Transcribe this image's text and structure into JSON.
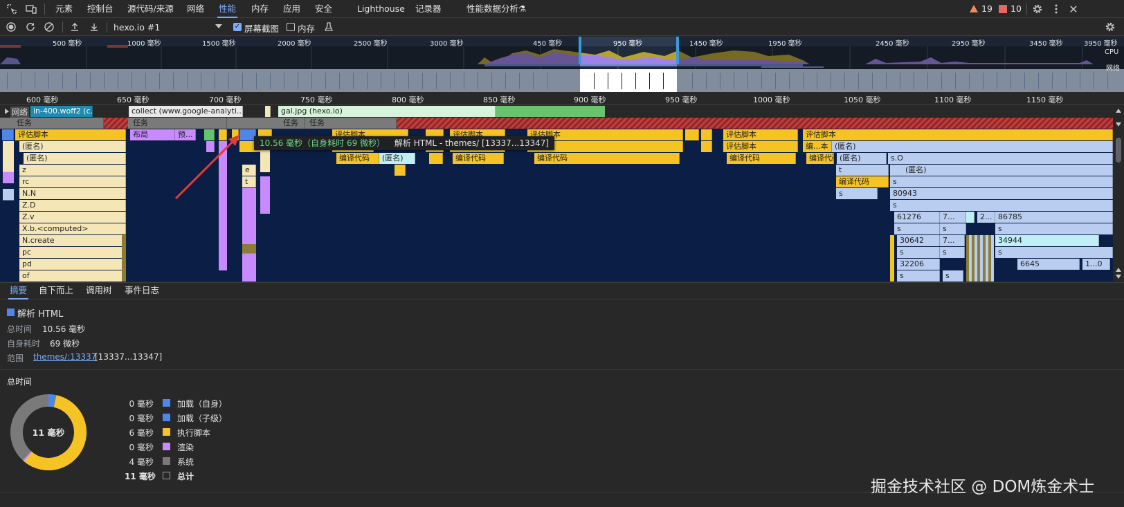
{
  "tabs": [
    "元素",
    "控制台",
    "源代码/来源",
    "网络",
    "性能",
    "内存",
    "应用",
    "安全",
    "Lighthouse",
    "记录器",
    "性能数据分析"
  ],
  "tab_beaker": "⚗",
  "warn_count": "19",
  "error_count": "10",
  "toolbar": {
    "profile": "hexo.io #1",
    "screenshot_label": "屏幕截图",
    "memory_label": "内存"
  },
  "overview_ticks": [
    "500 毫秒",
    "1000 毫秒",
    "1500 毫秒",
    "2000 毫秒",
    "2500 毫秒",
    "3000 毫秒",
    "450 毫秒",
    "950 毫秒",
    "1450 毫秒",
    "1950 毫秒",
    "2450 毫秒",
    "2950 毫秒",
    "3450 毫秒",
    "3950 毫秒"
  ],
  "overview_labels": {
    "cpu": "CPU",
    "net": "网络"
  },
  "ruler_ticks": [
    "600 毫秒",
    "650 毫秒",
    "700 毫秒",
    "750 毫秒",
    "800 毫秒",
    "850 毫秒",
    "900 毫秒",
    "950 毫秒",
    "1000 毫秒",
    "1050 毫秒",
    "1100 毫秒",
    "1150 毫秒"
  ],
  "network_track": {
    "label": "网络",
    "items": [
      "in-400.woff2 (c...",
      "collect (www.google-analyti...",
      "gal.jpg (hexo.io)"
    ]
  },
  "main_labels": {
    "task": "任务",
    "eval": "评估脚本",
    "anon": "(匿名)",
    "layout": "布局",
    "pre": "预...",
    "compile": "编译代码",
    "e": "e",
    "t": "t",
    "s": "s",
    "so": "s.O",
    "ellip": "编...本"
  },
  "stack_left": [
    "(匿名)",
    "(匿名)",
    "z",
    "rc",
    "N.N",
    "Z.D",
    "Z.v",
    "X.b.<computed>",
    "N.create",
    "pc",
    "pd",
    "of"
  ],
  "stack_right_nums": [
    "80943",
    "61276",
    "86785",
    "30642",
    "34944",
    "32206",
    "6645",
    "7...",
    "2...",
    "1...0"
  ],
  "tooltip": {
    "time": "10.56 毫秒",
    "self": "（自身耗时 69 微秒）",
    "text": "解析 HTML - themes/ [13337...13347]"
  },
  "bottom_tabs": [
    "摘要",
    "自下而上",
    "调用树",
    "事件日志"
  ],
  "summary": {
    "title": "解析 HTML",
    "total_label": "总时间",
    "total_value": "10.56 毫秒",
    "self_label": "自身耗时",
    "self_value": "69 微秒",
    "range_label": "范围",
    "range_link": "themes/:13337",
    "range_rest": "[13337...13347]",
    "section": "总时间",
    "donut_center": "11 毫秒",
    "legend": [
      {
        "value": "0 毫秒",
        "label": "加载（自身）",
        "color": "#4f86e8"
      },
      {
        "value": "0 毫秒",
        "label": "加载（子级）",
        "color": "#4f86e8"
      },
      {
        "value": "6 毫秒",
        "label": "执行脚本",
        "color": "#f6c324"
      },
      {
        "value": "0 毫秒",
        "label": "渲染",
        "color": "#c78aff"
      },
      {
        "value": "4 毫秒",
        "label": "系统",
        "color": "#7a7a7a"
      },
      {
        "value": "11 毫秒",
        "label": "总计",
        "color": "#282828"
      }
    ]
  },
  "watermark": "掘金技术社区 @ DOM炼金术士"
}
